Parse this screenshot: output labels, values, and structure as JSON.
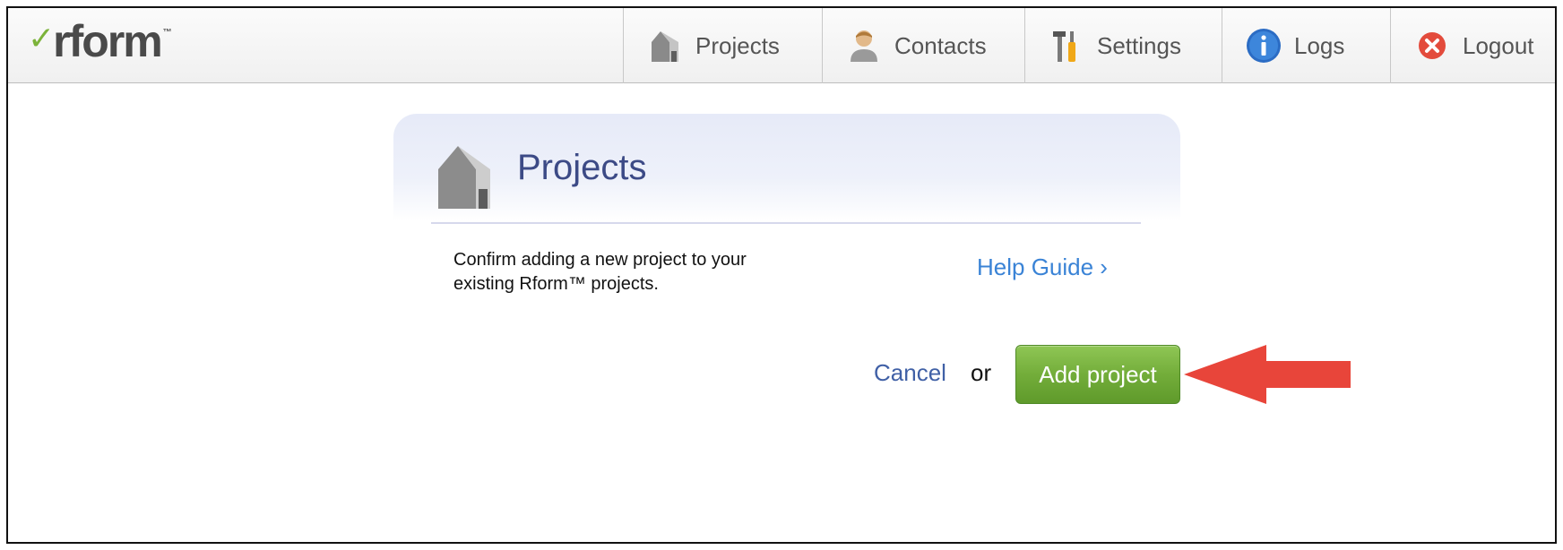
{
  "app": {
    "logo_text": "rform",
    "logo_tm": "™"
  },
  "nav": {
    "items": [
      {
        "label": "Projects",
        "icon": "house-icon"
      },
      {
        "label": "Contacts",
        "icon": "person-icon"
      },
      {
        "label": "Settings",
        "icon": "tools-icon"
      },
      {
        "label": "Logs",
        "icon": "info-icon"
      },
      {
        "label": "Logout",
        "icon": "close-circle-icon"
      }
    ]
  },
  "panel": {
    "title": "Projects",
    "description": "Confirm adding a new project to your existing Rform™ projects.",
    "help_label": "Help Guide ›",
    "cancel_label": "Cancel",
    "or_label": "or",
    "add_label": "Add project"
  },
  "colors": {
    "accent_green": "#73ad3a",
    "link_blue": "#3a83d6",
    "title_blue": "#3c4a86",
    "arrow_red": "#e8453a"
  }
}
